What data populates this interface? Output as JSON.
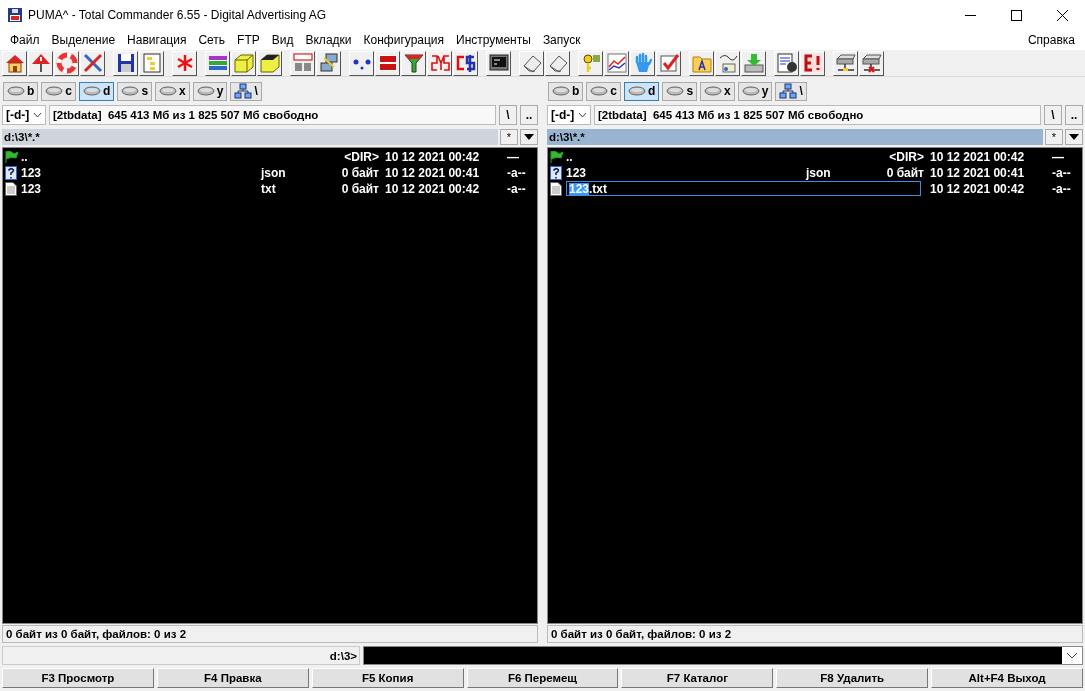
{
  "window": {
    "title": "PUMA^ - Total Commander 6.55 - Digital Advertising AG"
  },
  "menu": [
    "Файл",
    "Выделение",
    "Навигация",
    "Сеть",
    "FTP",
    "Вид",
    "Вкладки",
    "Конфигурация",
    "Инструменты",
    "Запуск"
  ],
  "menu_right": "Справка",
  "toolbar": [
    [
      {
        "kind": "home"
      },
      {
        "kind": "warning"
      },
      {
        "kind": "lifebuoy"
      },
      {
        "kind": "tools"
      }
    ],
    [
      {
        "kind": "floppy"
      },
      {
        "kind": "tree"
      }
    ],
    [
      {
        "kind": "asterisk"
      }
    ],
    [
      {
        "kind": "books"
      },
      {
        "kind": "cube"
      },
      {
        "kind": "darkcube"
      }
    ],
    [
      {
        "kind": "ftp"
      },
      {
        "kind": "network"
      }
    ],
    [
      {
        "kind": "dots"
      },
      {
        "kind": "exe"
      },
      {
        "kind": "filter"
      },
      {
        "kind": "sys"
      },
      {
        "kind": "cs"
      }
    ],
    [
      {
        "kind": "console"
      }
    ],
    [
      {
        "kind": "eraser"
      },
      {
        "kind": "eraser"
      }
    ],
    [
      {
        "kind": "key"
      },
      {
        "kind": "chart"
      },
      {
        "kind": "hand"
      },
      {
        "kind": "check"
      }
    ],
    [
      {
        "kind": "folder"
      },
      {
        "kind": "note"
      },
      {
        "kind": "download"
      }
    ],
    [
      {
        "kind": "doc"
      },
      {
        "kind": "ebang"
      }
    ],
    [
      {
        "kind": "drive"
      },
      {
        "kind": "drivex"
      }
    ]
  ],
  "panels": [
    {
      "active": false,
      "drives": [
        {
          "label": "b",
          "kind": "disk",
          "selected": false
        },
        {
          "label": "c",
          "kind": "disk",
          "selected": false
        },
        {
          "label": "d",
          "kind": "disk",
          "selected": true
        },
        {
          "label": "s",
          "kind": "disk",
          "selected": false
        },
        {
          "label": "x",
          "kind": "disk",
          "selected": false
        },
        {
          "label": "y",
          "kind": "disk",
          "selected": false
        },
        {
          "label": "\\",
          "kind": "net",
          "selected": false
        }
      ],
      "drive_combo": "[-d-]",
      "free_info": "[2tbdata]  645 413 Мб из 1 825 507 Мб свободно",
      "root_button": "\\",
      "up_button": "..",
      "path": "d:\\3\\*.*",
      "filter_button": "*",
      "files": [
        {
          "kind": "up",
          "name": "..",
          "size": "<DIR>",
          "date": "10 12 2021 00:42",
          "attr": "—"
        },
        {
          "kind": "unknown",
          "name": "123",
          "ext": "json",
          "size": "0 байт",
          "date": "10 12 2021 00:41",
          "attr": "-a--"
        },
        {
          "kind": "text",
          "name": "123",
          "ext": "txt",
          "size": "0 байт",
          "date": "10 12 2021 00:42",
          "attr": "-a--"
        }
      ],
      "status": "0 байт из 0 байт, файлов: 0 из 2"
    },
    {
      "active": true,
      "drives": [
        {
          "label": "b",
          "kind": "disk",
          "selected": false
        },
        {
          "label": "c",
          "kind": "disk",
          "selected": false
        },
        {
          "label": "d",
          "kind": "disk",
          "selected": true
        },
        {
          "label": "s",
          "kind": "disk",
          "selected": false
        },
        {
          "label": "x",
          "kind": "disk",
          "selected": false
        },
        {
          "label": "y",
          "kind": "disk",
          "selected": false
        },
        {
          "label": "\\",
          "kind": "net",
          "selected": false
        }
      ],
      "drive_combo": "[-d-]",
      "free_info": "[2tbdata]  645 413 Мб из 1 825 507 Мб свободно",
      "root_button": "\\",
      "up_button": "..",
      "path": "d:\\3\\*.*",
      "filter_button": "*",
      "files": [
        {
          "kind": "up",
          "name": "..",
          "size": "<DIR>",
          "date": "10 12 2021 00:42",
          "attr": "—"
        },
        {
          "kind": "unknown",
          "name": "123",
          "ext": "json",
          "size": "0 байт",
          "date": "10 12 2021 00:41",
          "attr": "-a--"
        },
        {
          "kind": "text",
          "date": "10 12 2021 00:42",
          "attr": "-a--",
          "rename": {
            "selected_text": "123",
            "rest_text": ".txt"
          }
        }
      ],
      "status": "0 байт из 0 байт, файлов: 0 из 2"
    }
  ],
  "command_line": {
    "prompt": "d:\\3>"
  },
  "function_keys": [
    "F3 Просмотр",
    "F4 Правка",
    "F5 Копия",
    "F6 Перемещ",
    "F7 Каталог",
    "F8 Удалить",
    "Alt+F4 Выход"
  ]
}
